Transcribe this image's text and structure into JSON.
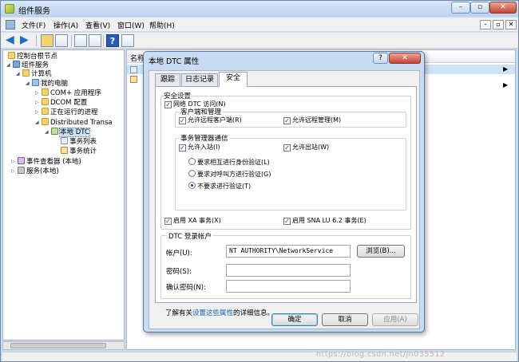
{
  "window": {
    "title": "组件服务"
  },
  "menu": {
    "items": [
      "文件(F)",
      "操作(A)",
      "查看(V)",
      "窗口(W)",
      "帮助(H)"
    ]
  },
  "mdi_buttons": [
    "–",
    "▫",
    "✕"
  ],
  "caption_buttons": {
    "minimize": "–",
    "maximize": "▫",
    "close": "✕"
  },
  "tree": {
    "nodes": [
      {
        "label": "控制台根节点",
        "icon": "folder-icon"
      },
      {
        "label": "组件服务",
        "icon": "component-icon"
      },
      {
        "label": "计算机",
        "icon": "folder-icon"
      },
      {
        "label": "我的电脑",
        "icon": "computer-icon"
      },
      {
        "label": "COM+ 应用程序",
        "icon": "folder-icon"
      },
      {
        "label": "DCOM 配置",
        "icon": "folder-icon"
      },
      {
        "label": "正在运行的进程",
        "icon": "folder-icon"
      },
      {
        "label": "Distributed Transa",
        "icon": "folder-icon"
      },
      {
        "label": "本地 DTC",
        "icon": "dtc-icon"
      },
      {
        "label": "事务列表",
        "icon": "list-icon"
      },
      {
        "label": "事务统计",
        "icon": "chart-icon"
      },
      {
        "label": "事件查看器 (本地)",
        "icon": "event-viewer-icon"
      },
      {
        "label": "服务(本地)",
        "icon": "services-icon"
      }
    ]
  },
  "list": {
    "column_name": "名称",
    "column_op": "操作"
  },
  "dialog": {
    "title": "本地 DTC 属性",
    "help": "?",
    "close": "✕",
    "tabs": [
      "跟踪",
      "日志记录",
      "安全"
    ],
    "security_settings": "安全设置",
    "network_dtc_access": "网络 DTC 访问(N)",
    "client_admin_group": "客户端和管理",
    "allow_remote_clients": "允许远程客户端(R)",
    "allow_remote_admin": "允许远程管理(M)",
    "tm_comm_group": "事务管理器通信",
    "allow_inbound": "允许入站(I)",
    "allow_outbound": "允许出站(W)",
    "auth_mutual": "要求相互进行身份验证(L)",
    "auth_incoming": "要求对呼叫方进行验证(G)",
    "auth_none": "不要求进行验证(T)",
    "enable_xa": "启用 XA 事务(X)",
    "enable_sna": "启用 SNA LU 6.2 事务(E)",
    "logon_group": "DTC 登录帐户",
    "account_label": "帐户(U):",
    "account_value": "NT AUTHORITY\\NetworkService",
    "browse": "浏览(B)...",
    "password_label": "密码(S):",
    "confirm_label": "确认密码(N):",
    "info_prefix": "了解有关",
    "info_link": "设置这些属性",
    "info_suffix": "的详细信息。",
    "ok": "确定",
    "cancel": "取消",
    "apply": "应用(A)"
  },
  "watermark": "https://blog.csdn.net/jh035512"
}
